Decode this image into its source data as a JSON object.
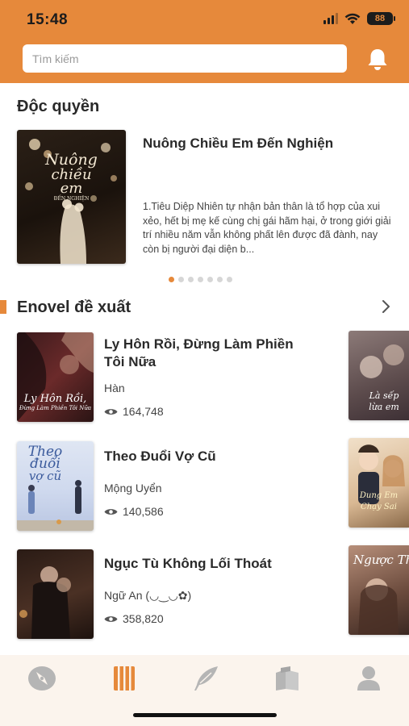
{
  "status_bar": {
    "time": "15:48",
    "battery": "88"
  },
  "header": {
    "search_placeholder": "Tìm kiếm",
    "bell_icon": "bell-icon",
    "color": "#e6893b"
  },
  "exclusive": {
    "title": "Độc quyền",
    "book": {
      "title": "Nuông Chiều Em Đến Nghiện",
      "description": "1.Tiêu Diệp Nhiên tự nhận bản thân là tổ hợp của xui xẻo, hết bị mẹ kế cùng chị gái hãm hại, ở trong giới giải trí nhiều năm vẫn không phất lên được đã đành, nay còn bị người đại diện b...",
      "cover_text": [
        "Nuông",
        "chiều",
        "em",
        "ĐẾN NGHIỆN"
      ]
    },
    "carousel": {
      "count": 7,
      "active_index": 0
    }
  },
  "recommended": {
    "title": "Enovel đề xuất",
    "more_icon": "chevron-right-icon",
    "books": [
      {
        "title": "Ly Hôn Rồi, Đừng Làm Phiền Tôi Nữa",
        "author": "Hàn",
        "views": "164,748",
        "cover_text": [
          "Ly Hôn Rồi,",
          "Đừng Làm Phiền Tôi Nữa"
        ]
      },
      {
        "title": "Theo Đuổi Vợ Cũ",
        "author": "Mộng Uyển",
        "views": "140,586",
        "cover_text": [
          "Theo",
          "đuổi",
          "vợ cũ"
        ]
      },
      {
        "title": "Ngục Tù Không Lối Thoát",
        "author": "Ngữ An (◡‿◡✿)",
        "views": "358,820",
        "cover_text": []
      }
    ],
    "side_covers": [
      {
        "cover_text": [
          "Là sếp",
          "lừa em"
        ]
      },
      {
        "cover_text": [
          "Dung Em",
          "Chạy Sai"
        ]
      },
      {
        "cover_text": [
          "Ngược Th"
        ]
      }
    ]
  },
  "tabbar": {
    "active": "library",
    "active_color": "#e6893b",
    "inactive_color": "#b5b5b5",
    "tabs": [
      {
        "id": "discover",
        "icon": "compass-icon"
      },
      {
        "id": "library",
        "icon": "book-icon"
      },
      {
        "id": "write",
        "icon": "feather-icon"
      },
      {
        "id": "bookshelf",
        "icon": "books-icon"
      },
      {
        "id": "profile",
        "icon": "user-icon"
      }
    ]
  }
}
